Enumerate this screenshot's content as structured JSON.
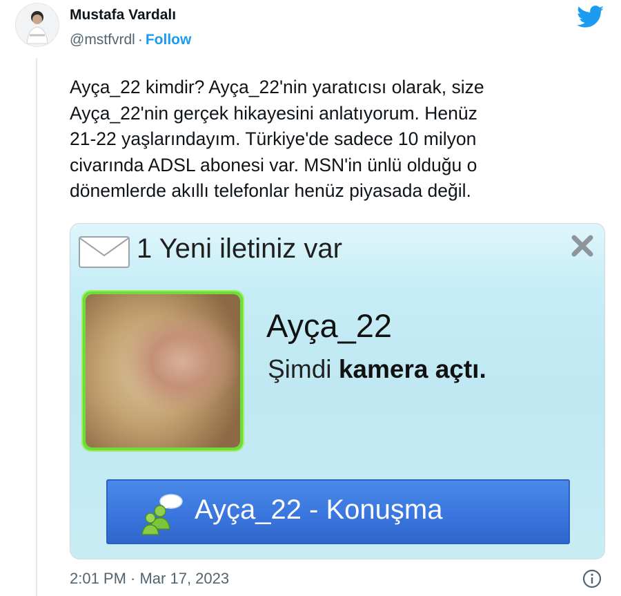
{
  "author": {
    "name": "Mustafa Vardalı",
    "handle": "@mstfvrdl",
    "separator": "·",
    "follow_label": "Follow",
    "avatar_icon": "person-avatar"
  },
  "brand": {
    "icon": "twitter-bird-icon",
    "color": "#1d9bf0"
  },
  "tweet": {
    "text": "Ayça_22 kimdir? Ayça_22'nin yaratıcısı olarak, size\nAyça_22'nin gerçek hikayesini anlatıyorum. Henüz\n21-22 yaşlarındayım. Türkiye'de sadece 10 milyon\ncivarında ADSL abonesi var. MSN'in ünlü olduğu o\ndönemlerde akıllı telefonlar henüz piyasada değil."
  },
  "media": {
    "notification_title": "1 Yeni iletiniz var",
    "contact_name": "Ayça_22",
    "status_prefix": "Şimdi ",
    "status_bold": "kamera açtı.",
    "chat_button_label": "Ayça_22 - Konuşma",
    "accent_green": "#6fdc3c",
    "button_blue": "#3a76de"
  },
  "footer": {
    "timestamp": "2:01 PM · Mar 17, 2023",
    "info_icon": "info-icon"
  }
}
